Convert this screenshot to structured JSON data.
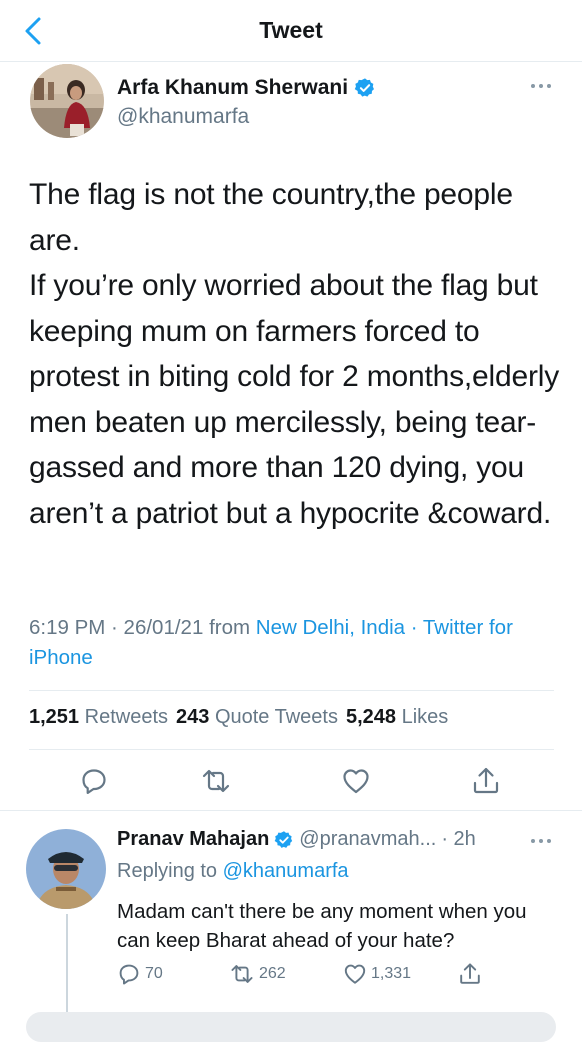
{
  "header": {
    "title": "Tweet",
    "back_icon": "chevron-left-icon"
  },
  "tweet": {
    "author_name": "Arfa Khanum Sherwani",
    "author_handle": "@khanumarfa",
    "verified_icon": "verified-badge-icon",
    "text": "The flag is not the country,the people are.\nIf you’re only worried about the flag but keeping mum on farmers forced to protest in biting cold for 2 months,elderly men beaten up mercilessly, being tear-gassed and more than 120 dying, you aren’t a patriot but a hypocrite &coward.",
    "time_date": "6:19 PM · 26/01/21",
    "from_word": "from",
    "location": "New Delhi, India",
    "separator": "·",
    "source": "Twitter for iPhone",
    "stats": {
      "retweets_count": "1,251",
      "retweets_label": "Retweets",
      "quotes_count": "243",
      "quotes_label": "Quote Tweets",
      "likes_count": "5,248",
      "likes_label": "Likes"
    }
  },
  "actions": [
    "reply-icon",
    "retweet-icon",
    "like-icon",
    "share-icon"
  ],
  "reply": {
    "author_name": "Pranav Mahajan",
    "author_handle": "@pranavmah...",
    "time": "· 2h",
    "replying_prefix": "Replying to",
    "replying_handle": "@khanumarfa",
    "text": "Madam can't there be any moment when you can keep Bharat ahead of your hate?",
    "reply_count": "70",
    "retweet_count": "262",
    "like_count": "1,331"
  },
  "colors": {
    "accent": "#1da1f2",
    "link": "#1b95e0",
    "muted": "#657786",
    "text": "#14171a"
  }
}
